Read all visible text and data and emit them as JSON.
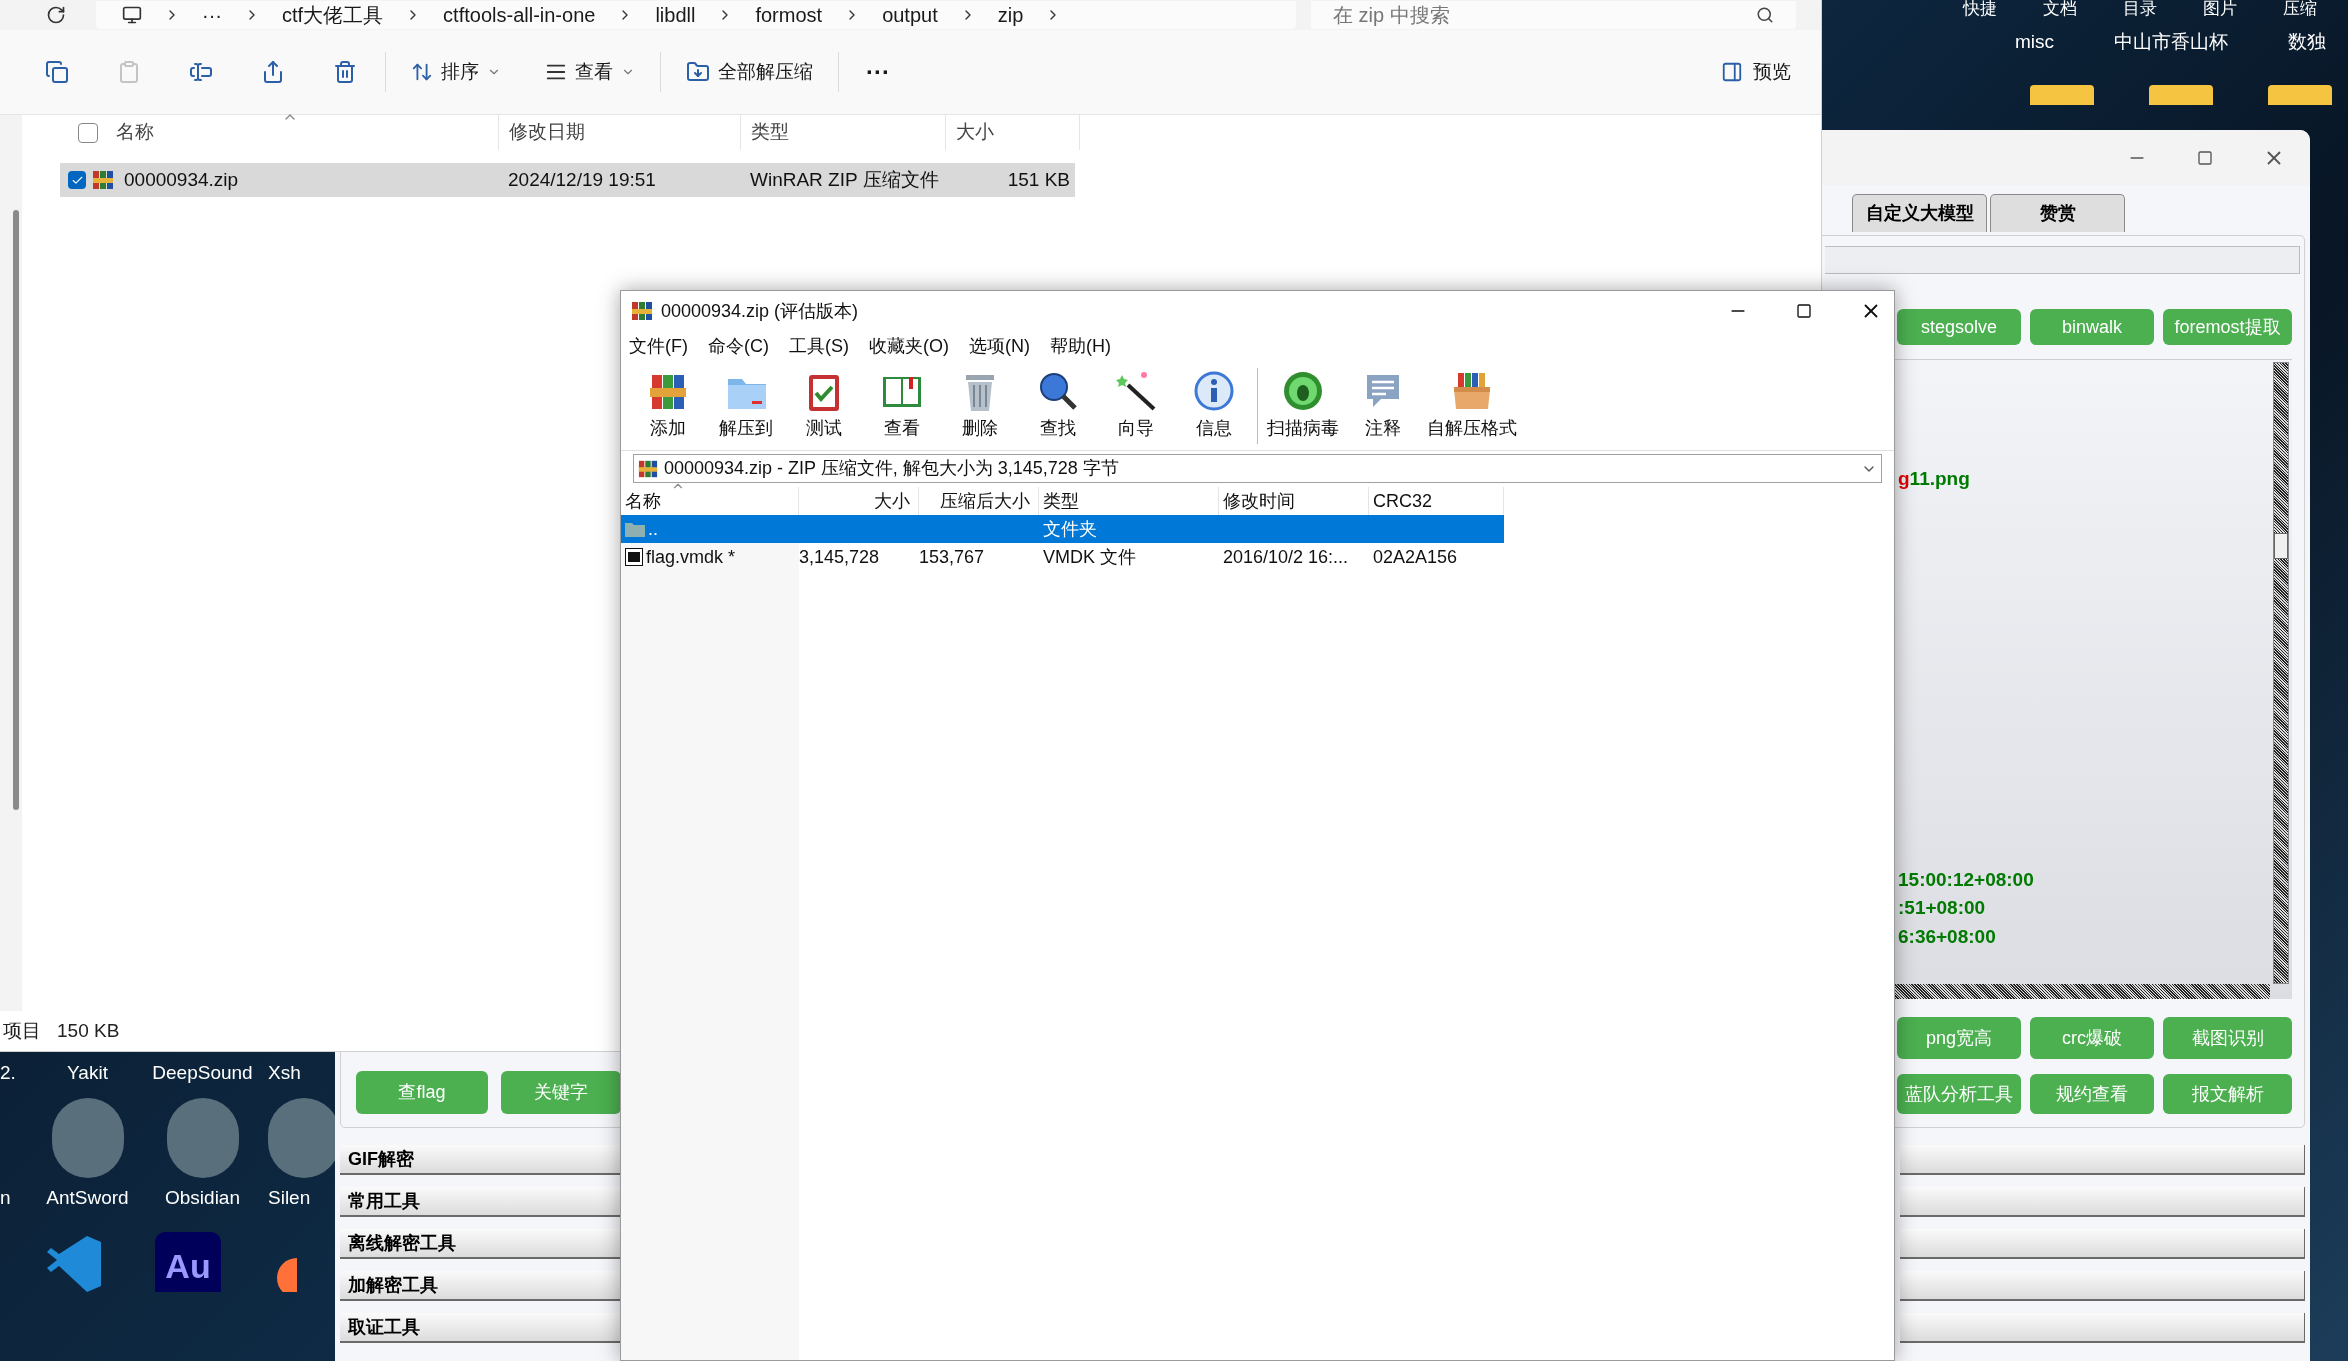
{
  "explorer": {
    "breadcrumb": [
      "···",
      "ctf大佬工具",
      "ctftools-all-in-one",
      "libdll",
      "formost",
      "output",
      "zip"
    ],
    "search": {
      "placeholder": "在 zip 中搜索"
    },
    "toolbar": [
      {
        "kind": "copy",
        "disabled": false
      },
      {
        "kind": "paste",
        "disabled": true
      },
      {
        "kind": "rename",
        "disabled": false
      },
      {
        "kind": "share",
        "disabled": false
      },
      {
        "kind": "delete",
        "disabled": false
      },
      {
        "kind": "sort",
        "label": "排序"
      },
      {
        "kind": "view",
        "label": "查看"
      },
      {
        "kind": "extract",
        "label": "全部解压缩"
      },
      {
        "kind": "more",
        "label": "···"
      }
    ],
    "preview": {
      "label": "预览"
    },
    "select_all": {
      "checked": false
    },
    "columns": [
      "名称",
      "修改日期",
      "类型",
      "大小"
    ],
    "rows": [
      {
        "name": "00000934.zip",
        "modified": "2024/12/19 19:51",
        "type": "WinRAR ZIP 压缩文件",
        "size": "151 KB",
        "selected": true
      }
    ],
    "status": {
      "count_label": "项目",
      "size": "150 KB"
    }
  },
  "desktop": {
    "top_labels": [
      "快捷",
      "文档",
      "目录",
      "图片",
      "压缩"
    ],
    "labels": [
      "misc",
      "中山市香山杯",
      "数独"
    ],
    "icons": [
      {
        "label": "2."
      },
      {
        "label": "Yakit"
      },
      {
        "label": "DeepSound"
      },
      {
        "label": "Xsh"
      },
      {
        "label": "n"
      },
      {
        "label": "AntSword"
      },
      {
        "label": "Obsidian"
      },
      {
        "label": "Silen"
      }
    ],
    "bottom_icons": [
      {
        "kind": "ribbon"
      },
      {
        "kind": "tile",
        "text": "Au"
      },
      {
        "kind": "flame"
      }
    ]
  },
  "tool_window": {
    "tabs": [
      {
        "label": "自定义大模型",
        "selected": false
      },
      {
        "label": "赞赏",
        "selected": false
      }
    ],
    "top_buttons": [
      "stegsolve",
      "binwalk",
      "foremost提取"
    ],
    "output": {
      "head": [
        {
          "segments": [
            {
              "text": "g",
              "color": "#e00000"
            },
            {
              "text": "11.png",
              "color": "#007a00"
            }
          ]
        }
      ],
      "tail": [
        {
          "segments": [
            {
              "text": "15:00:12+08:00",
              "color": "#007a00"
            }
          ]
        },
        {
          "segments": [
            {
              "text": ":51+08:00",
              "color": "#007a00"
            }
          ]
        },
        {
          "segments": [
            {
              "text": "6:36+08:00",
              "color": "#007a00"
            }
          ]
        }
      ]
    },
    "bottom_buttons": [
      [
        "png宽高",
        "crc爆破",
        "截图识别"
      ],
      [
        "蓝队分析工具",
        "规约查看",
        "报文解析"
      ]
    ],
    "left_buttons": [
      "查flag",
      "关键字"
    ],
    "sections": [
      "GIF解密",
      "常用工具",
      "离线解密工具",
      "加解密工具",
      "取证工具"
    ]
  },
  "winrar": {
    "title": "00000934.zip (评估版本)",
    "menu": [
      "文件(F)",
      "命令(C)",
      "工具(S)",
      "收藏夹(O)",
      "选项(N)",
      "帮助(H)"
    ],
    "toolbar": [
      [
        "添加",
        "解压到",
        "测试",
        "查看",
        "删除",
        "查找",
        "向导",
        "信息"
      ],
      [
        "扫描病毒",
        "注释",
        "自解压格式"
      ]
    ],
    "path": "00000934.zip - ZIP 压缩文件, 解包大小为 3,145,728 字节",
    "columns": [
      "名称",
      "大小",
      "压缩后大小",
      "类型",
      "修改时间",
      "CRC32"
    ],
    "rows": [
      {
        "kind": "parent",
        "name": "..",
        "type": "文件夹",
        "selected": true
      },
      {
        "kind": "file",
        "name": "flag.vmdk *",
        "size": "3,145,728",
        "packed": "153,767",
        "type": "VMDK 文件",
        "modified": "2016/10/2 16:...",
        "crc": "02A2A156",
        "selected": false
      }
    ]
  }
}
